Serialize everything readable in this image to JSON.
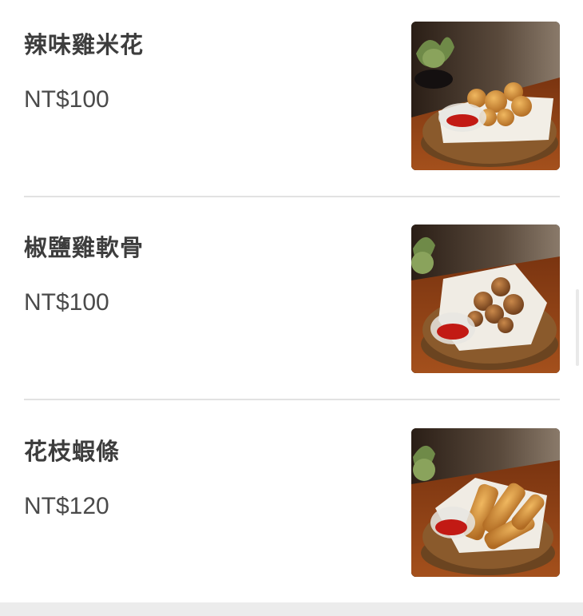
{
  "menu": {
    "items": [
      {
        "name": "辣味雞米花",
        "price": "NT$100",
        "image_icon": "popcorn-chicken-photo"
      },
      {
        "name": "椒鹽雞軟骨",
        "price": "NT$100",
        "image_icon": "salt-pepper-chicken-cartilage-photo"
      },
      {
        "name": "花枝蝦條",
        "price": "NT$120",
        "image_icon": "squid-shrimp-stick-photo"
      }
    ]
  },
  "colors": {
    "text_primary": "#3d3d3d",
    "divider": "#e2e2e2",
    "background": "#ffffff"
  }
}
